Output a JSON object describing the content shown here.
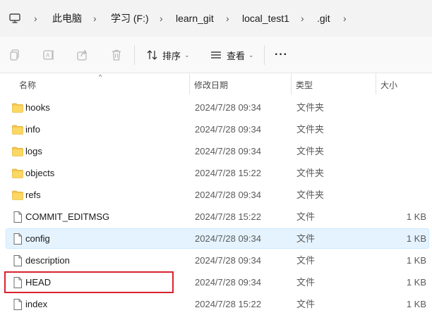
{
  "address_bar": {
    "crumbs": [
      "此电脑",
      "学习 (F:)",
      "learn_git",
      "local_test1",
      ".git"
    ]
  },
  "toolbar": {
    "sort_label": "排序",
    "view_label": "查看",
    "more_label": "···"
  },
  "columns": {
    "name": "名称",
    "date": "修改日期",
    "type": "类型",
    "size": "大小"
  },
  "files": [
    {
      "name": "hooks",
      "date": "2024/7/28 09:34",
      "type": "文件夹",
      "size": "",
      "kind": "folder"
    },
    {
      "name": "info",
      "date": "2024/7/28 09:34",
      "type": "文件夹",
      "size": "",
      "kind": "folder"
    },
    {
      "name": "logs",
      "date": "2024/7/28 09:34",
      "type": "文件夹",
      "size": "",
      "kind": "folder"
    },
    {
      "name": "objects",
      "date": "2024/7/28 15:22",
      "type": "文件夹",
      "size": "",
      "kind": "folder"
    },
    {
      "name": "refs",
      "date": "2024/7/28 09:34",
      "type": "文件夹",
      "size": "",
      "kind": "folder"
    },
    {
      "name": "COMMIT_EDITMSG",
      "date": "2024/7/28 15:22",
      "type": "文件",
      "size": "1 KB",
      "kind": "file"
    },
    {
      "name": "config",
      "date": "2024/7/28 09:34",
      "type": "文件",
      "size": "1 KB",
      "kind": "file"
    },
    {
      "name": "description",
      "date": "2024/7/28 09:34",
      "type": "文件",
      "size": "1 KB",
      "kind": "file"
    },
    {
      "name": "HEAD",
      "date": "2024/7/28 09:34",
      "type": "文件",
      "size": "1 KB",
      "kind": "file"
    },
    {
      "name": "index",
      "date": "2024/7/28 15:22",
      "type": "文件",
      "size": "1 KB",
      "kind": "file"
    }
  ],
  "selected_row": "config",
  "highlighted_row": "HEAD",
  "colors": {
    "highlight_border": "#d9232f",
    "selection_bg": "#e5f3ff",
    "folder": "#f8c84a"
  }
}
